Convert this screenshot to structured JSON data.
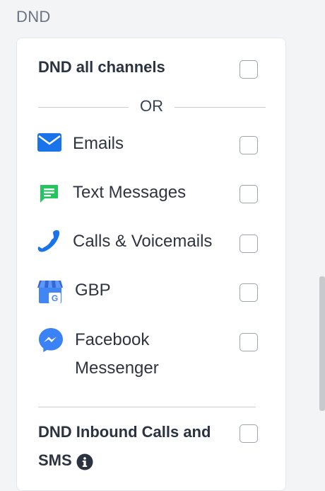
{
  "section": {
    "title": "DND"
  },
  "dnd_all": {
    "label": "DND all channels",
    "checked": false
  },
  "divider": {
    "or_text": "OR"
  },
  "channels": [
    {
      "label": "Emails",
      "icon": "email-icon",
      "color": "#1a73e8",
      "checked": false
    },
    {
      "label": "Text Messages",
      "icon": "sms-icon",
      "color": "#22c55e",
      "checked": false
    },
    {
      "label": "Calls & Voicemails",
      "icon": "phone-icon",
      "color": "#1a73e8",
      "checked": false
    },
    {
      "label": "GBP",
      "icon": "google-business-profile-icon",
      "color": "#4285f4",
      "checked": false
    },
    {
      "label_line1": "Facebook",
      "label_line2": "Messenger",
      "icon": "facebook-messenger-icon",
      "color": "#3b82f6",
      "checked": false
    }
  ],
  "inbound": {
    "label_line1": "DND Inbound Calls and",
    "label_line2": "SMS",
    "icon": "info-icon",
    "checked": false
  }
}
